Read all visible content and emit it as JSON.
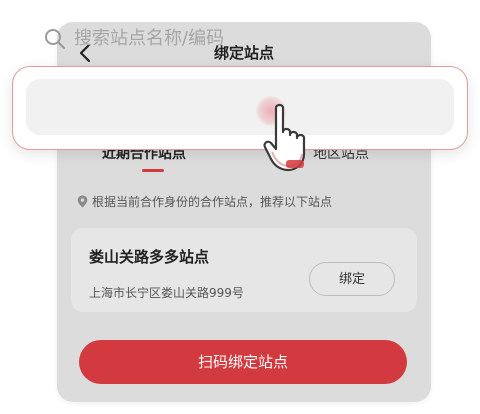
{
  "header": {
    "title": "绑定站点"
  },
  "search": {
    "placeholder": "搜索站点名称/编码"
  },
  "tabs": [
    {
      "label": "近期合作站点",
      "active": true
    },
    {
      "label": "地区站点",
      "active": false
    }
  ],
  "location_hint": "根据当前合作身份的合作站点，推荐以下站点",
  "stations": [
    {
      "name": "娄山关路多多站点",
      "address": "上海市长宁区娄山关路999号",
      "action_label": "绑定"
    }
  ],
  "footer": {
    "scan_button_label": "扫码绑定站点"
  },
  "icons": [
    "back-arrow-icon",
    "search-icon",
    "location-pin-icon",
    "hand-pointer-icon"
  ],
  "colors": {
    "accent": "#d33a40",
    "callout_border": "#e59aa0",
    "panel_bg": "#dcdcdc"
  }
}
